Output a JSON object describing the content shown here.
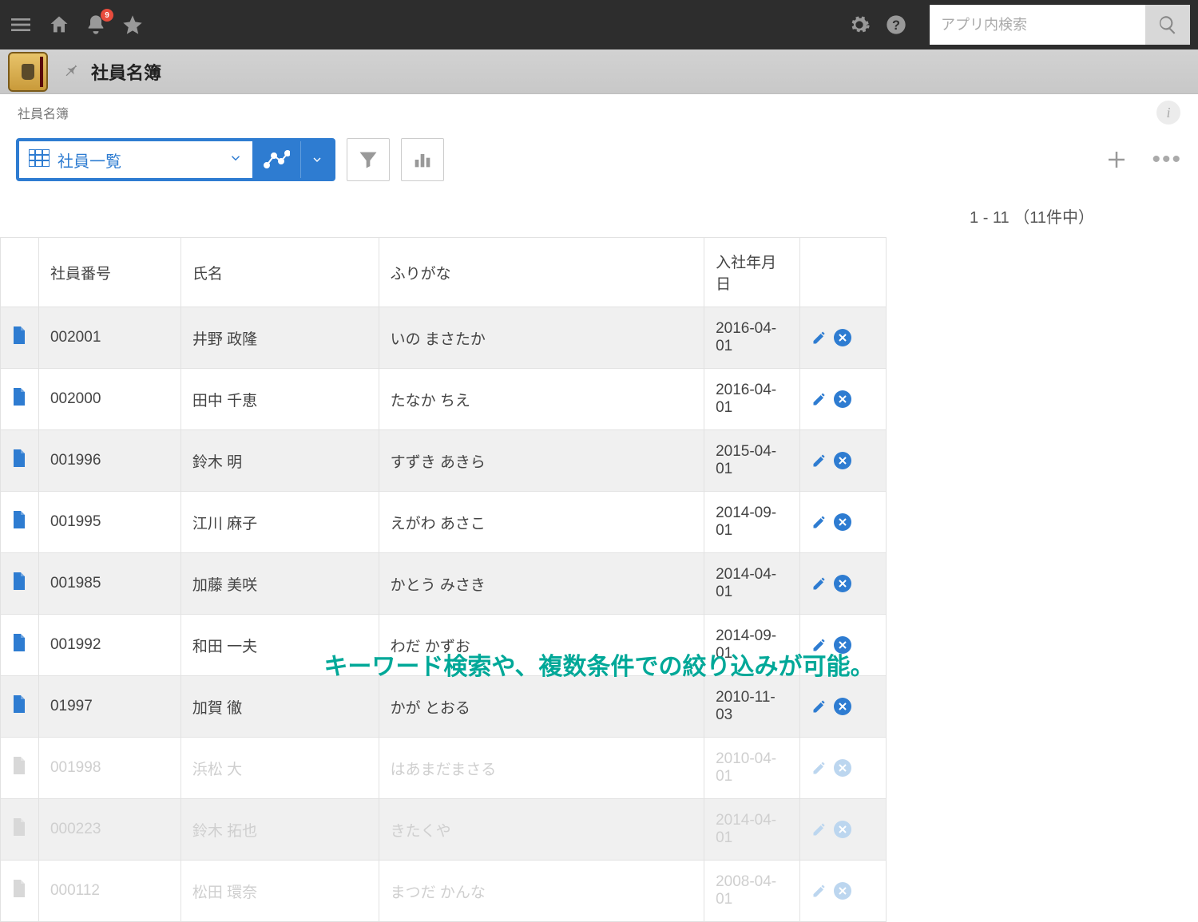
{
  "topbar": {
    "notification_count": "9",
    "search_placeholder": "アプリ内検索"
  },
  "app": {
    "title": "社員名簿"
  },
  "breadcrumb": "社員名簿",
  "toolbar": {
    "view_label": "社員一覧"
  },
  "pagination": {
    "text": "1 - 11 （11件中）"
  },
  "table": {
    "headers": {
      "emp_no": "社員番号",
      "name": "氏名",
      "kana": "ふりがな",
      "hire_date": "入社年月日"
    },
    "rows": [
      {
        "emp_no": "002001",
        "name": "井野 政隆",
        "kana": "いの まさたか",
        "hire_date": "2016-04-01",
        "faded": false
      },
      {
        "emp_no": "002000",
        "name": "田中 千恵",
        "kana": "たなか ちえ",
        "hire_date": "2016-04-01",
        "faded": false
      },
      {
        "emp_no": "001996",
        "name": "鈴木 明",
        "kana": "すずき あきら",
        "hire_date": "2015-04-01",
        "faded": false
      },
      {
        "emp_no": "001995",
        "name": "江川 麻子",
        "kana": "えがわ あさこ",
        "hire_date": "2014-09-01",
        "faded": false
      },
      {
        "emp_no": "001985",
        "name": "加藤 美咲",
        "kana": "かとう みさき",
        "hire_date": "2014-04-01",
        "faded": false
      },
      {
        "emp_no": "001992",
        "name": "和田 一夫",
        "kana": "わだ かずお",
        "hire_date": "2014-09-01",
        "faded": false
      },
      {
        "emp_no": "01997",
        "name": "加賀 徹",
        "kana": "かが とおる",
        "hire_date": "2010-11-03",
        "faded": false
      },
      {
        "emp_no": "001998",
        "name": "浜松 大",
        "kana": "はあまだまさる",
        "hire_date": "2010-04-01",
        "faded": true
      },
      {
        "emp_no": "000223",
        "name": "鈴木 拓也",
        "kana": "きたくや",
        "hire_date": "2014-04-01",
        "faded": true
      },
      {
        "emp_no": "000112",
        "name": "松田 環奈",
        "kana": "まつだ かんな",
        "hire_date": "2008-04-01",
        "faded": true
      }
    ]
  },
  "overlay_caption": "キーワード検索や、複数条件での絞り込みが可能。"
}
